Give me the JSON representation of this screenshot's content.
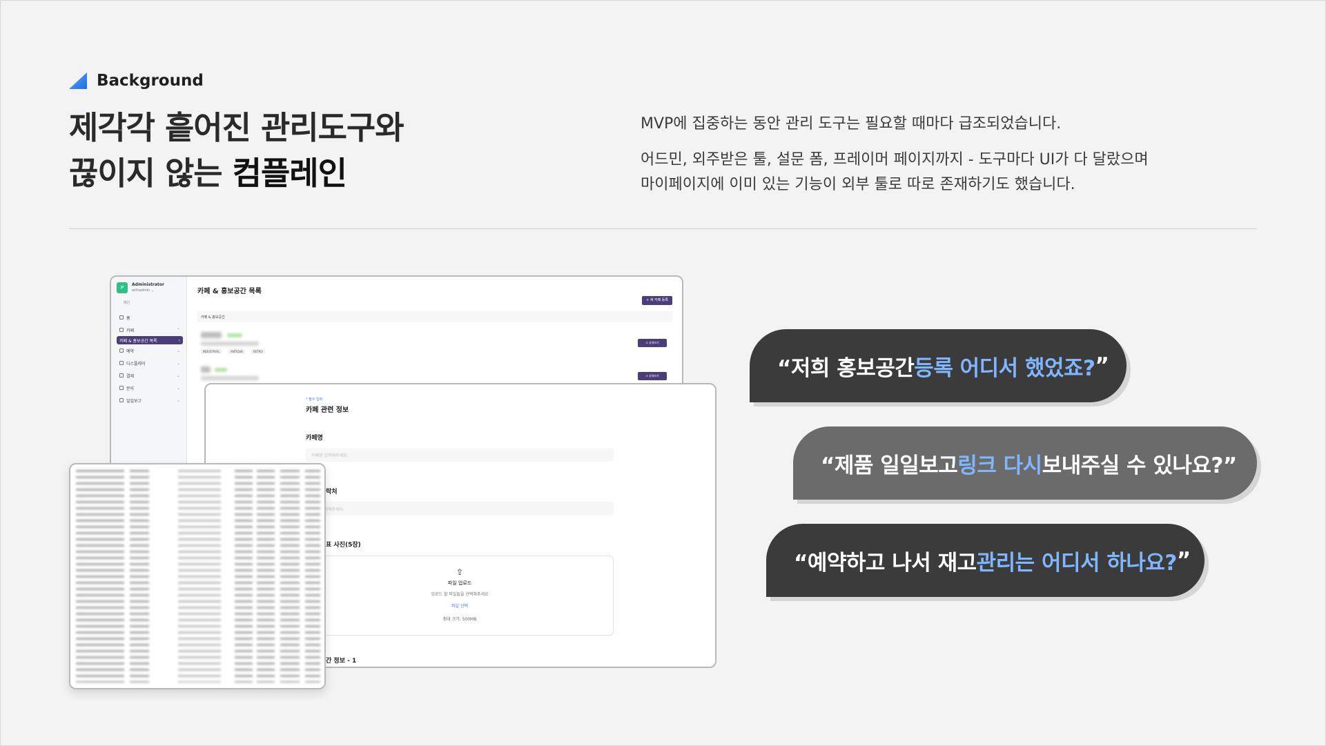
{
  "section": {
    "label": "Background"
  },
  "headline": {
    "line1": "제각각 흩어진 관리도구와",
    "line2_prefix": "끊이지 않는 ",
    "line2_bold": "컴플레인"
  },
  "description": {
    "lead": "MVP에 집중하는 동안 관리 도구는 필요할 때마다 급조되었습니다.",
    "line2": "어드민, 외주받은 툴, 설문 폼, 프레이머 페이지까지 - 도구마다 UI가 다 달랐으며",
    "line3": "마이페이지에 이미 있는 기능이 외부 툴로 따로 존재하기도 했습니다."
  },
  "admin_window": {
    "logo": "P",
    "admin_name": "Administrator",
    "admin_id": "withadmin ⌄",
    "side_heading": "메인",
    "menu": [
      {
        "label": "홈"
      },
      {
        "label": "카페"
      },
      {
        "label": "카페 & 홍보공간 목록"
      },
      {
        "label": "예약"
      },
      {
        "label": "디스플레이"
      },
      {
        "label": "결제"
      },
      {
        "label": "문의"
      },
      {
        "label": "일일보고"
      }
    ],
    "title": "카페 & 홍보공간 목록",
    "new_button": "+ 새 카페 등록",
    "subbar": "카페 & 홍보공간",
    "tags": [
      "INDUSTRIAL",
      "ANTIQUE",
      "RETRO"
    ],
    "detail_button": "⊙ 상세보기"
  },
  "form_window": {
    "required_note": "* 필수 입력",
    "section_title": "카페 관련 정보",
    "cafe_name_label": "카페명",
    "cafe_name_placeholder": "카페명 입력해주세요.",
    "contact_label": "락처",
    "contact_placeholder": "락처 입력해주세요.",
    "photo_label": "표 사진(5장)",
    "upload_title": "파일 업로드",
    "upload_desc": "업로드 할 파일들을 선택해주세요",
    "upload_link": "파일 선택",
    "upload_size": "최대 크기: 500MB",
    "space_info_label": "간 정보 - 1"
  },
  "bubbles": [
    {
      "prefix": "“저희 홍보공간 ",
      "highlight": "등록 어디서 했었죠?",
      "suffix": "”"
    },
    {
      "prefix": "“제품 일일보고 ",
      "highlight": "링크 다시",
      "suffix": " 보내주실 수 있나요?”"
    },
    {
      "prefix": "“예약하고 나서 재고 ",
      "highlight": "관리는 어디서 하나요?",
      "suffix": "”"
    }
  ],
  "colors": {
    "accent_blue": "#7fb6ff",
    "bubble_dark": "#3b3b3b",
    "bubble_mid": "#6b6b6b",
    "admin_purple": "#4a3d7a"
  }
}
